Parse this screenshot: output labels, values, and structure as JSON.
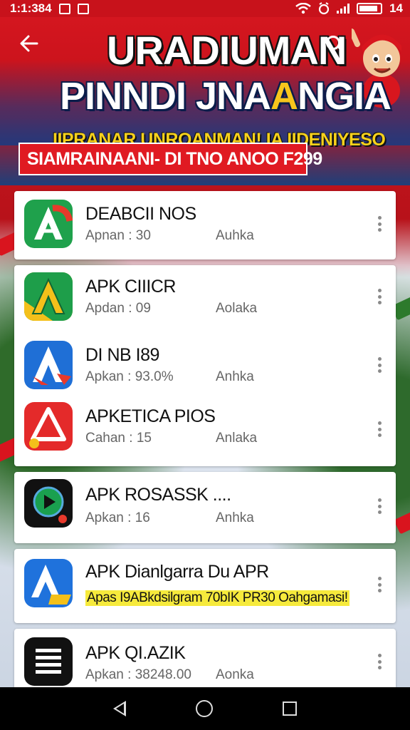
{
  "status_bar": {
    "time": "1:1:384",
    "battery": "14"
  },
  "header": {
    "title_line1": "URADIUMAN",
    "title_line2_a": "PINNDI JNA",
    "title_line2_b": "A",
    "title_line2_c": "NGIA",
    "subtitle": "IIPRANAR UNROANMAN! IA IIDENIYESO",
    "promo": "SIAMRAINAANI- DI TNO ANOO F299"
  },
  "apps": [
    {
      "name": "DEABCII NOS",
      "meta": "Apnan : 30",
      "extra": "Auhka"
    },
    {
      "name": "APK CIIICR",
      "meta": "Apdan : 09",
      "extra": "Aolaka"
    },
    {
      "name": "DI NB I89",
      "meta": "Apkan : 93.0%",
      "extra": "Anhka"
    },
    {
      "name": "APKETICA PIOS",
      "meta": "Cahan : 15",
      "extra": "Anlaka"
    },
    {
      "name": "APK ROSASSK ....",
      "meta": "Apkan : 16",
      "extra": "Anhka"
    },
    {
      "name": "APK Dianlgarra Du APR",
      "highlight": "Apas I9ABkdsilgram 70bIK PR30 Oahgamasi!"
    },
    {
      "name": "APK QI.AZIK",
      "meta": "Apkan : 38248.00",
      "extra": "Aonka"
    }
  ],
  "icons": {
    "back": "arrow-left-icon",
    "search": "search-icon",
    "more": "more-vertical-icon",
    "nav_back": "triangle-back-icon",
    "nav_home": "circle-home-icon",
    "nav_recent": "square-recent-icon"
  },
  "colors": {
    "brand_red": "#d4161f",
    "title_yellow": "#f7c51c",
    "highlight_yellow": "#f6ea3c"
  }
}
